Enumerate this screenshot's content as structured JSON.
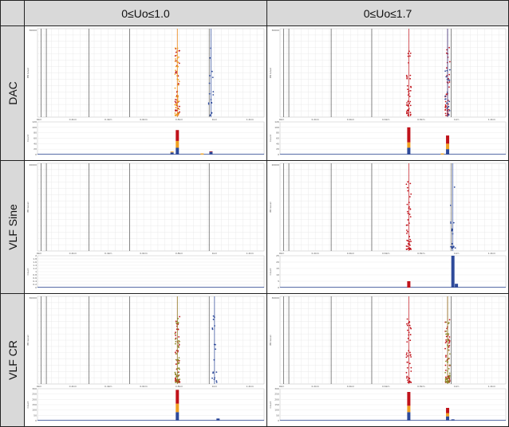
{
  "columns": [
    "0≤Uo≤1.0",
    "0≤Uo≤1.7"
  ],
  "rows": [
    "DAC",
    "VLF Sine",
    "VLF CR"
  ],
  "colors": {
    "red": "#c0121a",
    "orange": "#f0a020",
    "blue": "#2e4a9a",
    "olive": "#8b8b2a",
    "grid": "#e6e6e6",
    "marker": "#555555"
  },
  "chart_data": [
    {
      "row": "DAC",
      "column": "0≤Uo≤1.0",
      "type": "scatter+histogram",
      "scatter": {
        "ylabel": "PD Level",
        "ymax_label": "30000",
        "clusters": [
          {
            "x": 0.79,
            "color": "red"
          },
          {
            "x": 0.79,
            "color": "orange"
          },
          {
            "x": 0.98,
            "color": "blue"
          }
        ]
      },
      "histogram": {
        "ylabel": "Count",
        "yticks": [
          "120",
          "100",
          "80",
          "60",
          "40",
          "20",
          "0"
        ],
        "bars": [
          {
            "x": 0.79,
            "stack": [
              {
                "c": "blue",
                "v": 25
              },
              {
                "c": "orange",
                "v": 25
              },
              {
                "c": "red",
                "v": 40
              }
            ]
          },
          {
            "x": 0.76,
            "stack": [
              {
                "c": "blue",
                "v": 8
              },
              {
                "c": "orange",
                "v": 3
              }
            ]
          },
          {
            "x": 0.98,
            "stack": [
              {
                "c": "blue",
                "v": 10
              },
              {
                "c": "red",
                "v": 2
              }
            ]
          },
          {
            "x": 0.93,
            "stack": [
              {
                "c": "orange",
                "v": 4
              }
            ]
          }
        ]
      }
    },
    {
      "row": "DAC",
      "column": "0≤Uo≤1.7",
      "type": "scatter+histogram",
      "scatter": {
        "ylabel": "PD Level",
        "ymax_label": "30000",
        "clusters": [
          {
            "x": 0.73,
            "color": "red"
          },
          {
            "x": 0.95,
            "color": "red"
          },
          {
            "x": 0.95,
            "color": "blue"
          }
        ]
      },
      "histogram": {
        "ylabel": "Count",
        "yticks": [
          "120",
          "100",
          "80",
          "60",
          "40",
          "20",
          "0"
        ],
        "bars": [
          {
            "x": 0.73,
            "stack": [
              {
                "c": "blue",
                "v": 25
              },
              {
                "c": "orange",
                "v": 20
              },
              {
                "c": "red",
                "v": 55
              }
            ]
          },
          {
            "x": 0.95,
            "stack": [
              {
                "c": "blue",
                "v": 20
              },
              {
                "c": "orange",
                "v": 20
              },
              {
                "c": "red",
                "v": 30
              }
            ]
          },
          {
            "x": 0.92,
            "stack": [
              {
                "c": "orange",
                "v": 4
              }
            ]
          }
        ]
      }
    },
    {
      "row": "VLF Sine",
      "column": "0≤Uo≤1.0",
      "type": "scatter+histogram",
      "scatter": {
        "ylabel": "PD Level",
        "ymax_label": "20000",
        "clusters": []
      },
      "histogram": {
        "ylabel": "Count",
        "yticks": [
          "2",
          "1.8",
          "1.6",
          "1.4",
          "1.2",
          "1",
          "0.8",
          "0.6",
          "0.4",
          "0.2",
          "0"
        ],
        "bars": []
      }
    },
    {
      "row": "VLF Sine",
      "column": "0≤Uo≤1.7",
      "type": "scatter+histogram",
      "scatter": {
        "ylabel": "PD Level",
        "ymax_label": "20000",
        "clusters": [
          {
            "x": 0.73,
            "color": "red"
          },
          {
            "x": 0.98,
            "color": "blue"
          }
        ]
      },
      "histogram": {
        "ylabel": "Count",
        "yticks": [
          "25",
          "20",
          "15",
          "10",
          "5",
          "0"
        ],
        "bars": [
          {
            "x": 0.73,
            "stack": [
              {
                "c": "red",
                "v": 5
              }
            ]
          },
          {
            "x": 0.98,
            "stack": [
              {
                "c": "blue",
                "v": 25
              }
            ]
          },
          {
            "x": 1.0,
            "stack": [
              {
                "c": "blue",
                "v": 3
              }
            ]
          }
        ]
      }
    },
    {
      "row": "VLF CR",
      "column": "0≤Uo≤1.0",
      "type": "scatter+histogram",
      "scatter": {
        "ylabel": "PD Level",
        "ymax_label": "30000",
        "clusters": [
          {
            "x": 0.79,
            "color": "red"
          },
          {
            "x": 0.79,
            "color": "olive"
          },
          {
            "x": 1.0,
            "color": "blue"
          }
        ]
      },
      "histogram": {
        "ylabel": "Count",
        "yticks": [
          "300",
          "250",
          "200",
          "150",
          "100",
          "50",
          "0"
        ],
        "bars": [
          {
            "x": 0.79,
            "stack": [
              {
                "c": "blue",
                "v": 80
              },
              {
                "c": "orange",
                "v": 80
              },
              {
                "c": "red",
                "v": 130
              }
            ]
          },
          {
            "x": 1.02,
            "stack": [
              {
                "c": "blue",
                "v": 20
              }
            ]
          }
        ]
      }
    },
    {
      "row": "VLF CR",
      "column": "0≤Uo≤1.7",
      "type": "scatter+histogram",
      "scatter": {
        "ylabel": "PD Level",
        "ymax_label": "30000",
        "clusters": [
          {
            "x": 0.73,
            "color": "red"
          },
          {
            "x": 0.95,
            "color": "red"
          },
          {
            "x": 0.95,
            "color": "olive"
          }
        ]
      },
      "histogram": {
        "ylabel": "Count",
        "yticks": [
          "300",
          "250",
          "200",
          "150",
          "100",
          "50",
          "0"
        ],
        "bars": [
          {
            "x": 0.73,
            "stack": [
              {
                "c": "blue",
                "v": 80
              },
              {
                "c": "orange",
                "v": 60
              },
              {
                "c": "red",
                "v": 130
              }
            ]
          },
          {
            "x": 0.95,
            "stack": [
              {
                "c": "blue",
                "v": 40
              },
              {
                "c": "orange",
                "v": 30
              },
              {
                "c": "red",
                "v": 50
              }
            ]
          },
          {
            "x": 0.98,
            "stack": [
              {
                "c": "blue",
                "v": 12
              }
            ]
          }
        ]
      }
    }
  ],
  "x_ticks": [
    "0km",
    "0.2km",
    "0.4km",
    "0.6km",
    "0.8km",
    "1km",
    "1.2km"
  ]
}
